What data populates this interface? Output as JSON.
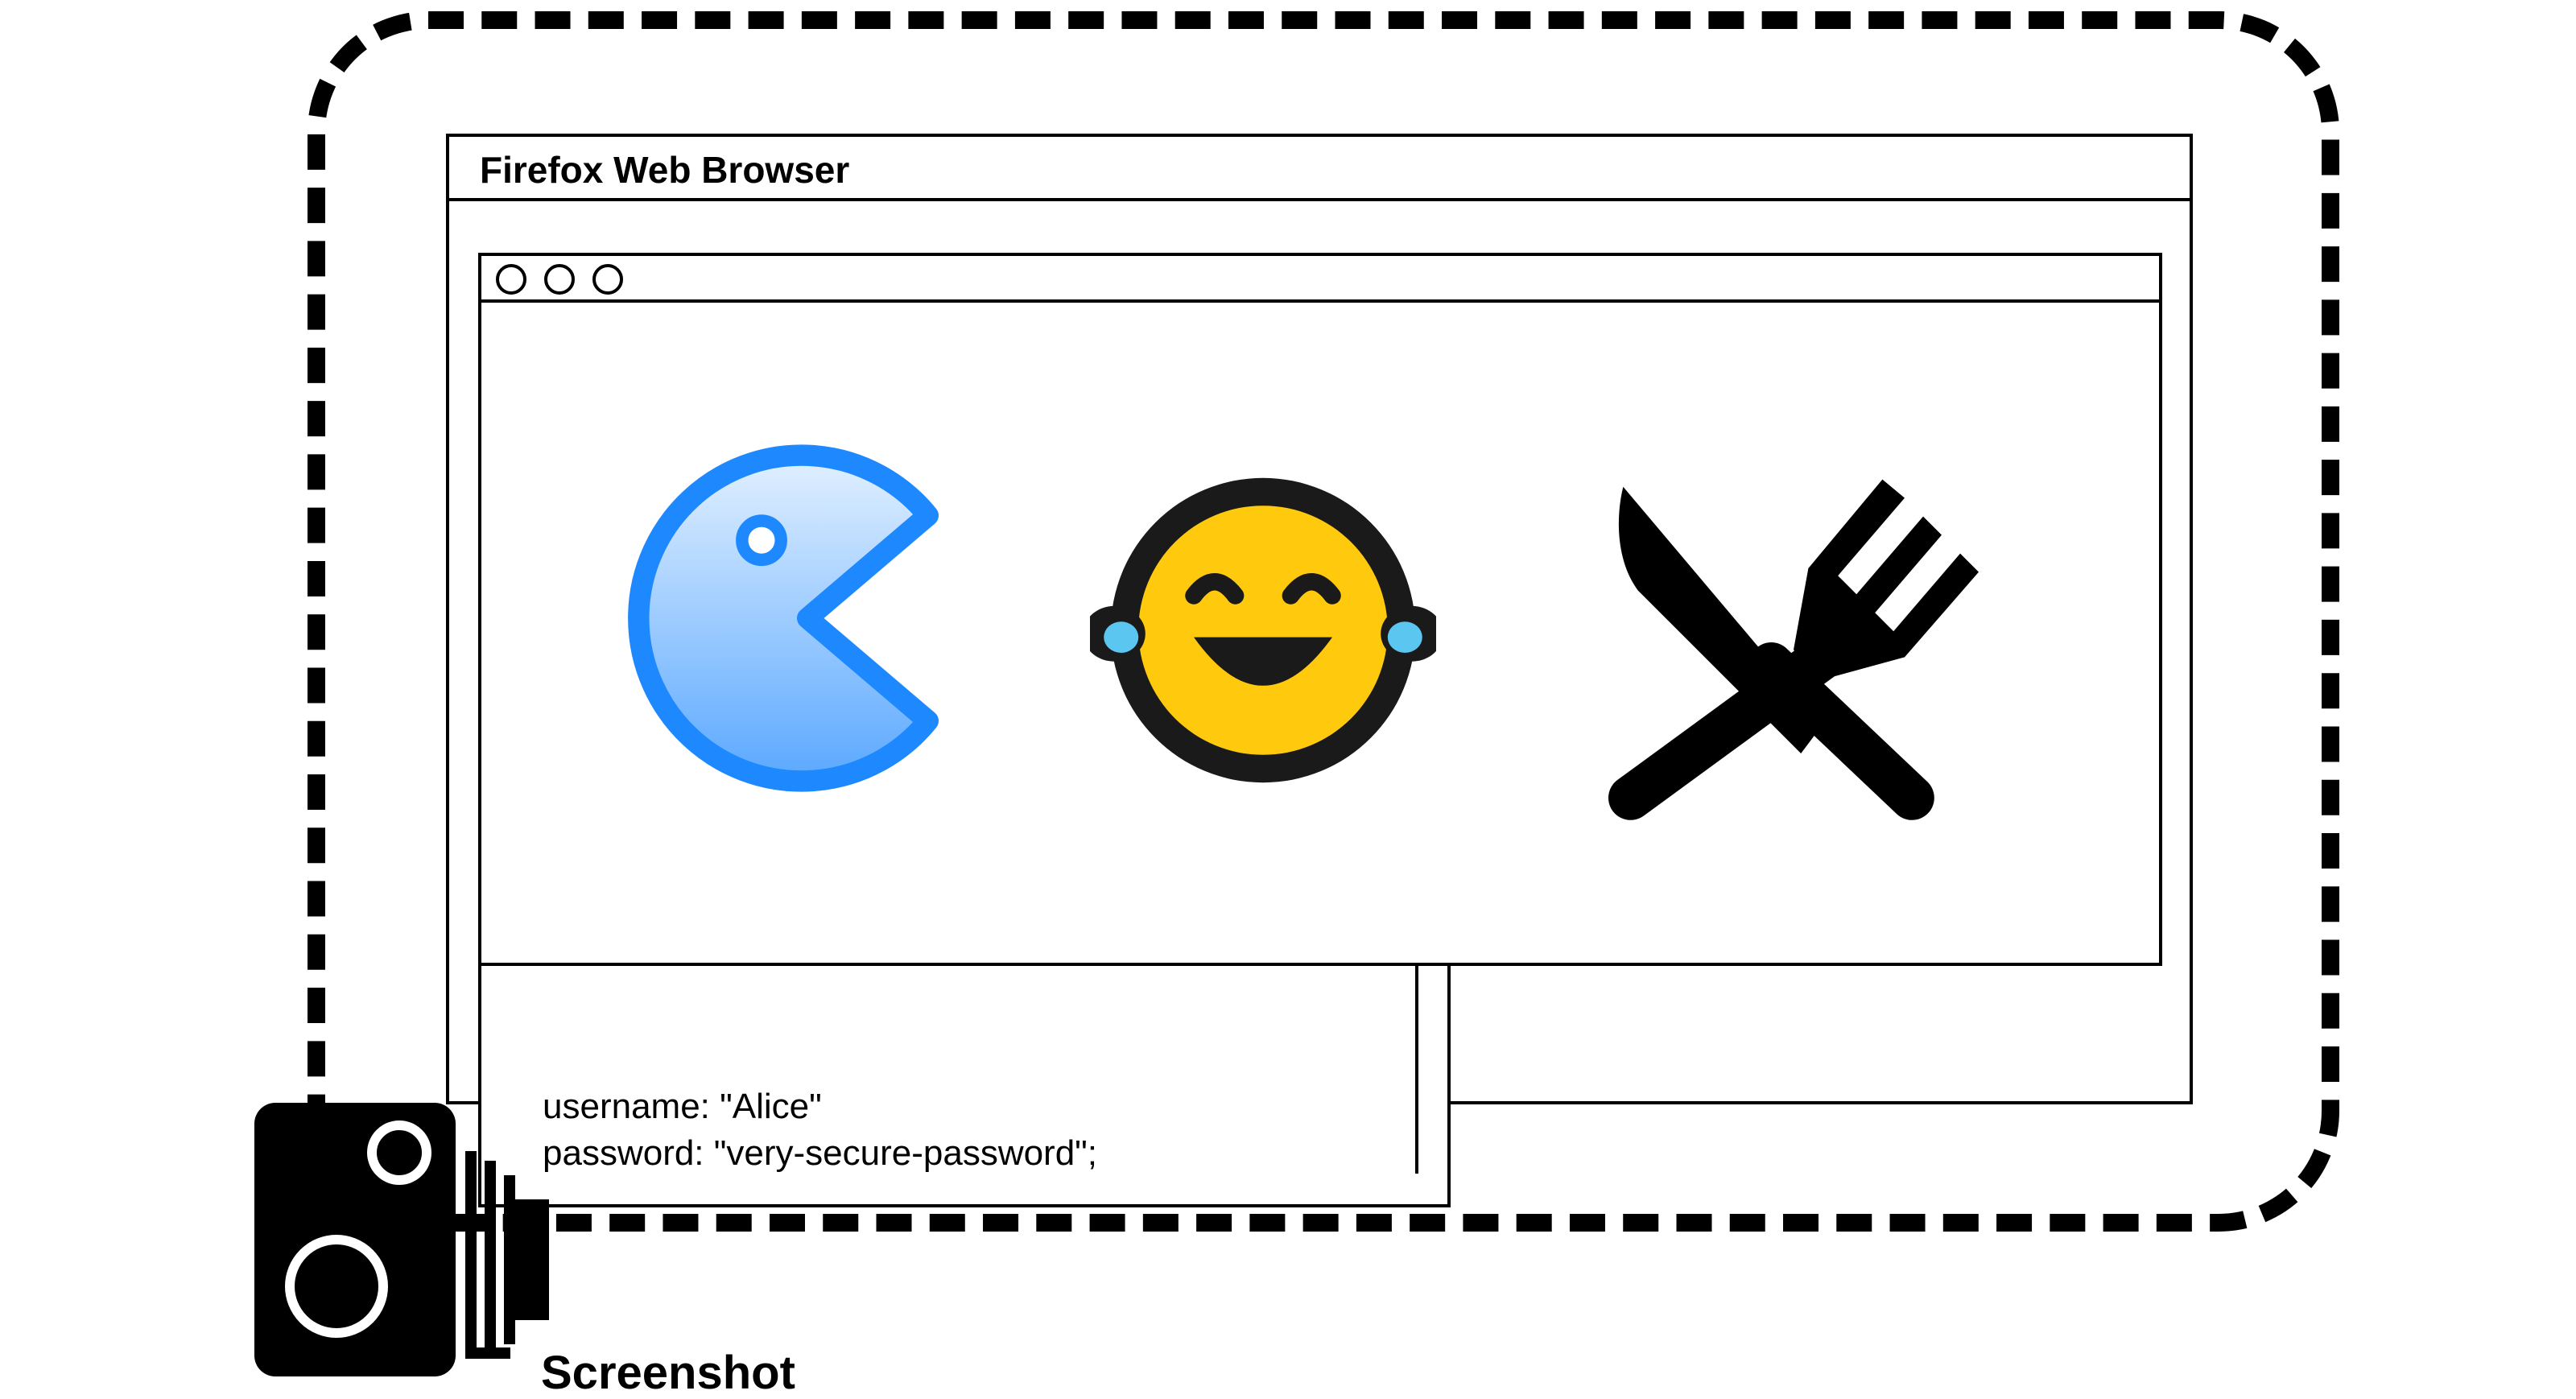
{
  "browser": {
    "title": "Firefox Web Browser"
  },
  "code_snippet": {
    "username_line": "username: \"Alice\"",
    "password_line": "password: \"very-secure-password\";"
  },
  "page_icons": [
    "pacman-icon",
    "face-with-tears-of-joy-icon",
    "fork-and-knife-icon"
  ],
  "capture": {
    "label": "Screenshot",
    "icon": "camera-icon"
  },
  "colors": {
    "outline": "#000000",
    "pacman_blue": "#1e88ff",
    "pacman_fill_light": "#d9ebff",
    "emoji_yellow": "#ffc90e",
    "tear_blue": "#5bc6f0"
  }
}
